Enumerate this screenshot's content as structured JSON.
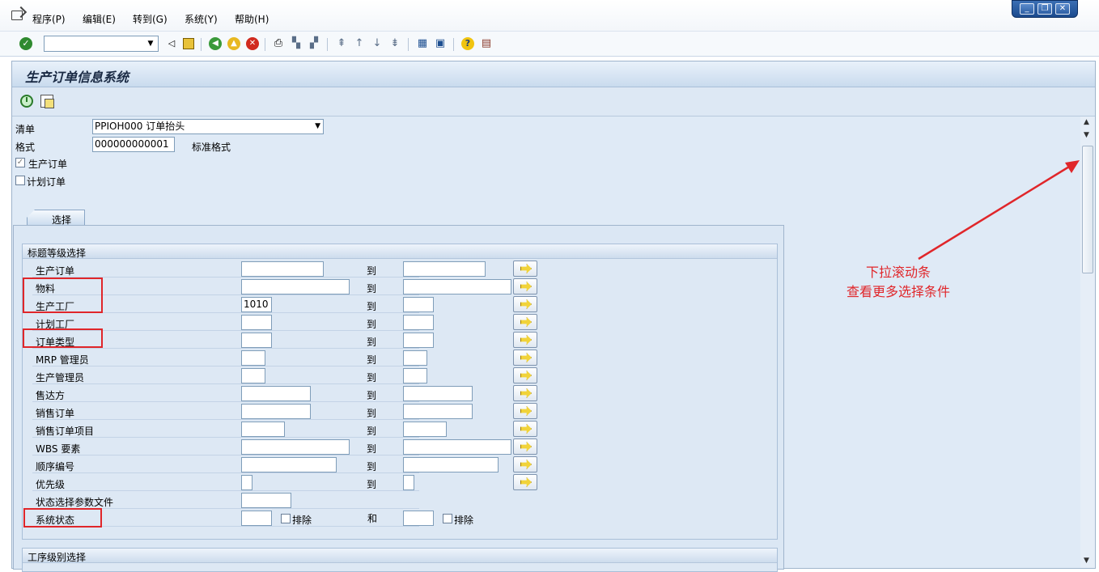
{
  "menu": {
    "items": [
      "程序(P)",
      "编辑(E)",
      "转到(G)",
      "系统(Y)",
      "帮助(H)"
    ]
  },
  "window_controls": {
    "minimize": "_",
    "restore": "❐",
    "close": "✕"
  },
  "toolbar": {
    "command_field": ""
  },
  "screen": {
    "title": "生产订单信息系统"
  },
  "header": {
    "list_label": "清单",
    "list_value": "PPIOH000 订单抬头",
    "layout_label": "格式",
    "layout_value": "000000000001",
    "layout_desc": "标准格式",
    "prod_order_label": "生产订单",
    "prod_order_checked": true,
    "planned_order_label": "计划订单",
    "planned_order_checked": false
  },
  "tab": {
    "label": "选择"
  },
  "selection_group": {
    "title": "标题等级选择",
    "to_label": "到",
    "and_label": "和",
    "exclude_label": "排除",
    "rows": [
      {
        "label": "生产订单",
        "from": "",
        "to": ""
      },
      {
        "label": "物料",
        "from": "",
        "to": ""
      },
      {
        "label": "生产工厂",
        "from": "1010",
        "to": ""
      },
      {
        "label": "计划工厂",
        "from": "",
        "to": ""
      },
      {
        "label": "订单类型",
        "from": "",
        "to": ""
      },
      {
        "label": "MRP 管理员",
        "from": "",
        "to": ""
      },
      {
        "label": "生产管理员",
        "from": "",
        "to": ""
      },
      {
        "label": "售达方",
        "from": "",
        "to": ""
      },
      {
        "label": "销售订单",
        "from": "",
        "to": ""
      },
      {
        "label": "销售订单项目",
        "from": "",
        "to": ""
      },
      {
        "label": "WBS 要素",
        "from": "",
        "to": ""
      },
      {
        "label": "顺序编号",
        "from": "",
        "to": ""
      },
      {
        "label": "优先级",
        "from": "",
        "to": ""
      },
      {
        "label": "状态选择参数文件",
        "from": ""
      },
      {
        "label": "系统状态",
        "from": "",
        "to": ""
      }
    ]
  },
  "operation_group": {
    "title": "工序级别选择"
  },
  "annotation": {
    "line1": "下拉滚动条",
    "line2": "查看更多选择条件"
  },
  "colors": {
    "annotation": "#e0262a",
    "frame_bg": "#dfeaf6"
  }
}
